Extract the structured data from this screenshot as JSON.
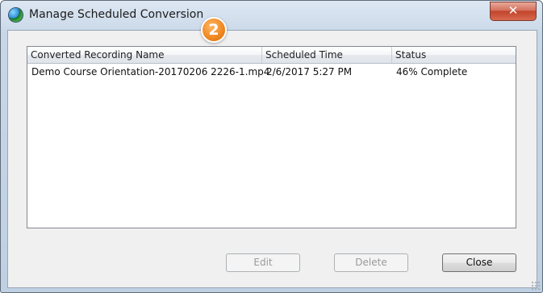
{
  "window": {
    "title": "Manage Scheduled Conversion",
    "close_glyph": "✕",
    "step_badge": "2",
    "badge_color": "#f08a24"
  },
  "table": {
    "columns": [
      "Converted Recording Name",
      "Scheduled Time",
      "Status"
    ],
    "rows": [
      {
        "name": "Demo Course Orientation-20170206 2226-1.mp4",
        "time": "2/6/2017 5:27 PM",
        "status": "46% Complete"
      }
    ]
  },
  "buttons": {
    "edit": "Edit",
    "delete": "Delete",
    "close": "Close"
  },
  "icons": {
    "app": "globe-icon",
    "close": "close-icon"
  }
}
